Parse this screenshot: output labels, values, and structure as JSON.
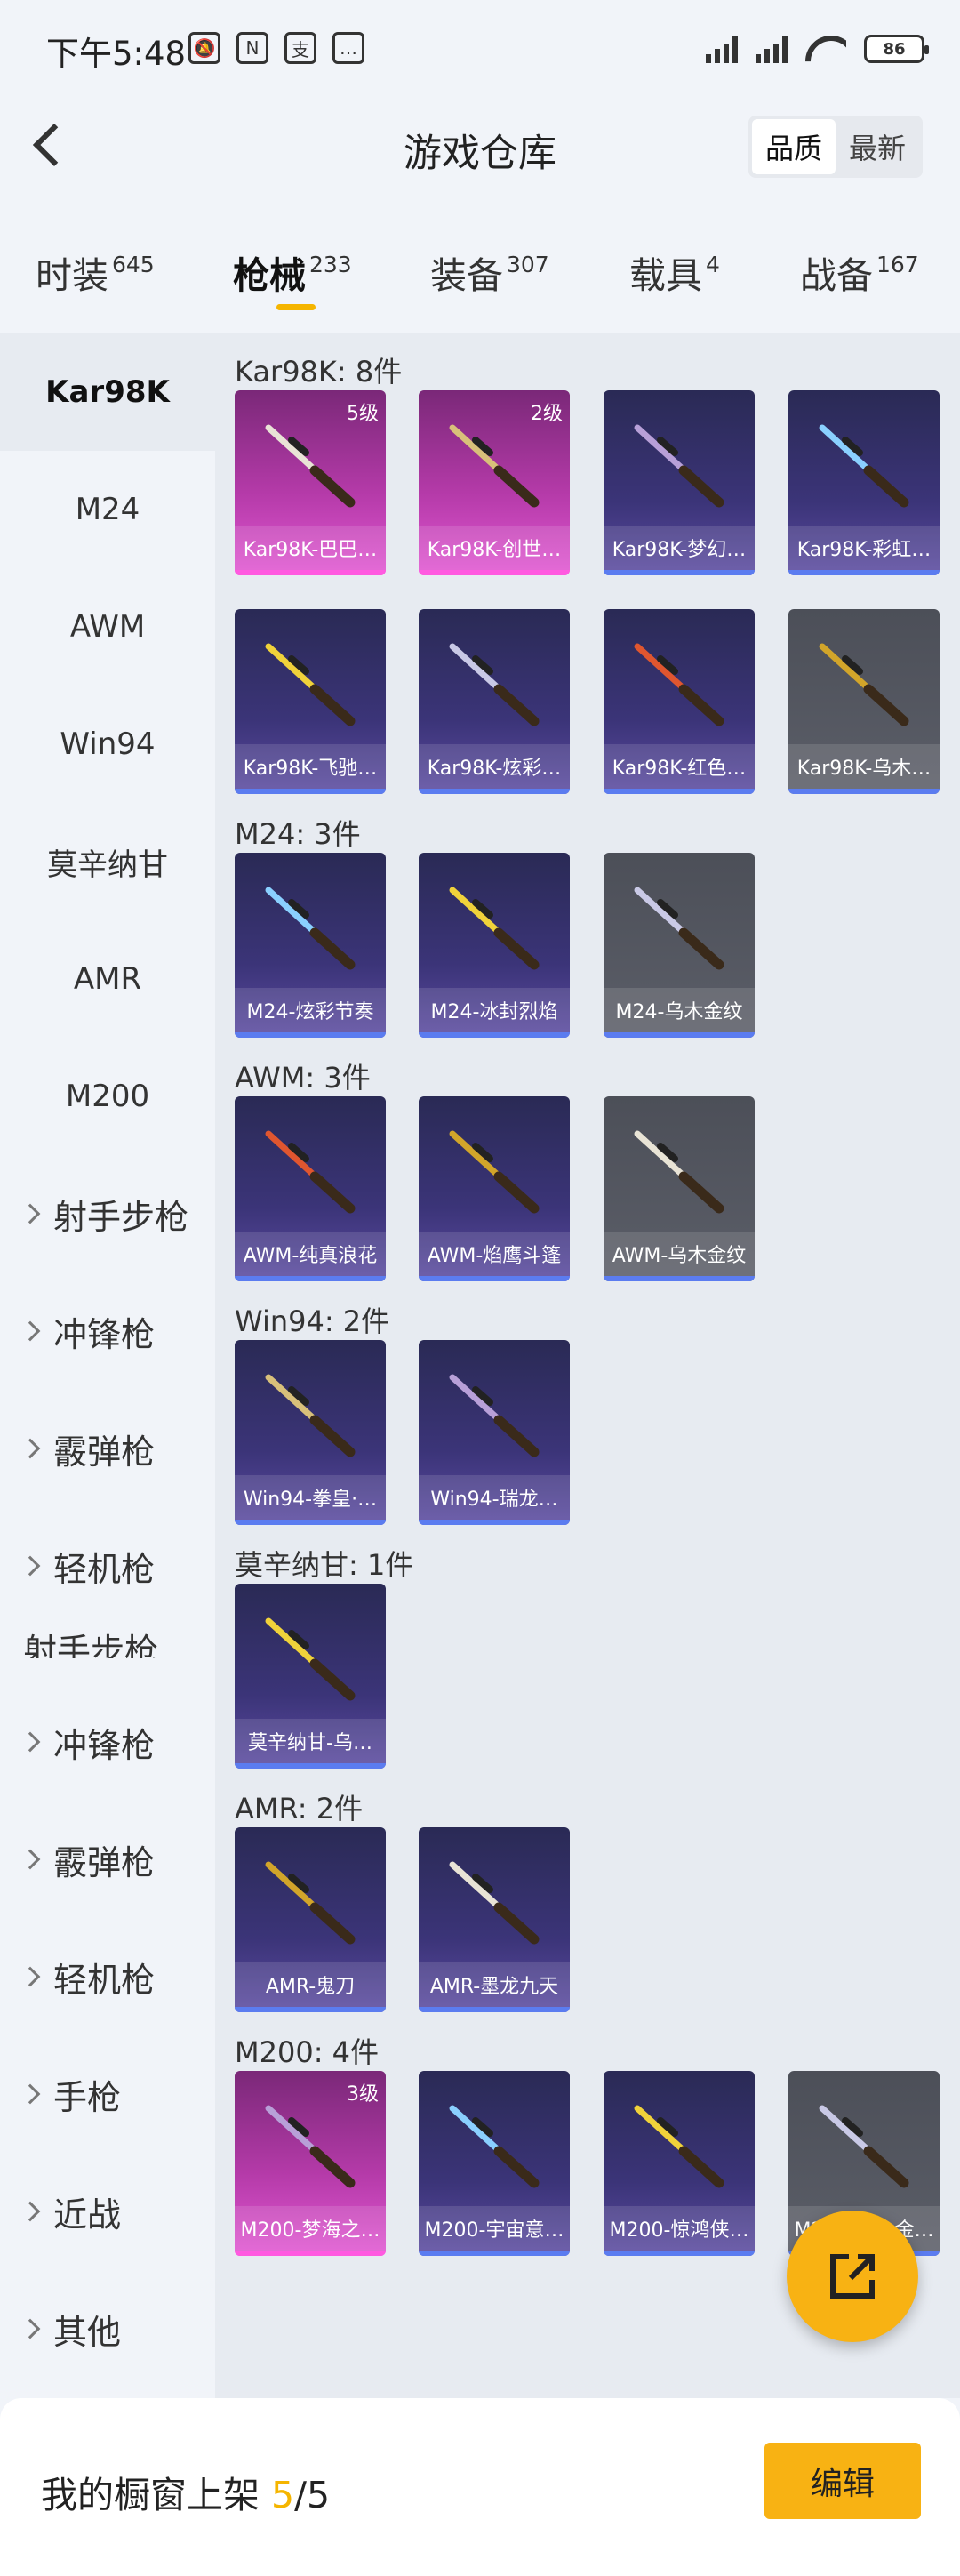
{
  "status_bar": {
    "time": "下午5:48",
    "battery": "86"
  },
  "header": {
    "title": "游戏仓库",
    "sort": [
      "品质",
      "最新"
    ]
  },
  "tabs": [
    {
      "label": "时装",
      "count": "645"
    },
    {
      "label": "枪械",
      "count": "233"
    },
    {
      "label": "装备",
      "count": "307"
    },
    {
      "label": "载具",
      "count": "4"
    },
    {
      "label": "战备",
      "count": "167"
    }
  ],
  "sidebar": {
    "items": [
      "Kar98K",
      "M24",
      "AWM",
      "Win94",
      "莫辛纳甘",
      "AMR",
      "M200"
    ],
    "groups": [
      "射手步枪",
      "冲锋枪",
      "霰弹枪",
      "轻机枪",
      "射手步枪",
      "冲锋枪",
      "霰弹枪",
      "轻机枪",
      "手枪",
      "近战",
      "其他"
    ]
  },
  "sections": [
    {
      "title": "Kar98K: 8件",
      "items": [
        {
          "name": "Kar98K-巴巴…",
          "level": "5级",
          "rarity": "pink"
        },
        {
          "name": "Kar98K-创世…",
          "level": "2级",
          "rarity": "pink"
        },
        {
          "name": "Kar98K-梦幻…",
          "level": "",
          "rarity": "purple"
        },
        {
          "name": "Kar98K-彩虹…",
          "level": "",
          "rarity": "purple"
        },
        {
          "name": "Kar98K-飞驰…",
          "level": "",
          "rarity": "purple"
        },
        {
          "name": "Kar98K-炫彩…",
          "level": "",
          "rarity": "purple"
        },
        {
          "name": "Kar98K-红色…",
          "level": "",
          "rarity": "purple"
        },
        {
          "name": "Kar98K-乌木…",
          "level": "",
          "rarity": "gray"
        }
      ]
    },
    {
      "title": "M24: 3件",
      "items": [
        {
          "name": "M24-炫彩节奏",
          "level": "",
          "rarity": "purple"
        },
        {
          "name": "M24-冰封烈焰",
          "level": "",
          "rarity": "purple"
        },
        {
          "name": "M24-乌木金纹",
          "level": "",
          "rarity": "gray"
        }
      ]
    },
    {
      "title": "AWM: 3件",
      "items": [
        {
          "name": "AWM-纯真浪花",
          "level": "",
          "rarity": "purple"
        },
        {
          "name": "AWM-焰鹰斗篷",
          "level": "",
          "rarity": "purple"
        },
        {
          "name": "AWM-乌木金纹",
          "level": "",
          "rarity": "gray"
        }
      ]
    },
    {
      "title": "Win94: 2件",
      "items": [
        {
          "name": "Win94-拳皇·…",
          "level": "",
          "rarity": "purple"
        },
        {
          "name": "Win94-瑞龙…",
          "level": "",
          "rarity": "purple"
        }
      ]
    },
    {
      "title": "莫辛纳甘: 1件",
      "items": [
        {
          "name": "莫辛纳甘-乌…",
          "level": "",
          "rarity": "purple"
        }
      ]
    },
    {
      "title": "AMR: 2件",
      "items": [
        {
          "name": "AMR-鬼刀",
          "level": "",
          "rarity": "purple"
        },
        {
          "name": "AMR-墨龙九天",
          "level": "",
          "rarity": "purple"
        }
      ]
    },
    {
      "title": "M200: 4件",
      "items": [
        {
          "name": "M200-梦海之…",
          "level": "3级",
          "rarity": "pink"
        },
        {
          "name": "M200-宇宙意…",
          "level": "",
          "rarity": "purple"
        },
        {
          "name": "M200-惊鸿侠…",
          "level": "",
          "rarity": "purple"
        },
        {
          "name": "M200-乌木金…",
          "level": "",
          "rarity": "gray"
        }
      ]
    }
  ],
  "bottom": {
    "label": "我的橱窗上架 ",
    "shown": "5",
    "separator": "/",
    "total": "5",
    "edit_label": "编辑"
  },
  "colors": {
    "accent": "#f8b213",
    "pink": "#e157d2",
    "purple": "#3b3478",
    "gray": "#5b5e68"
  }
}
